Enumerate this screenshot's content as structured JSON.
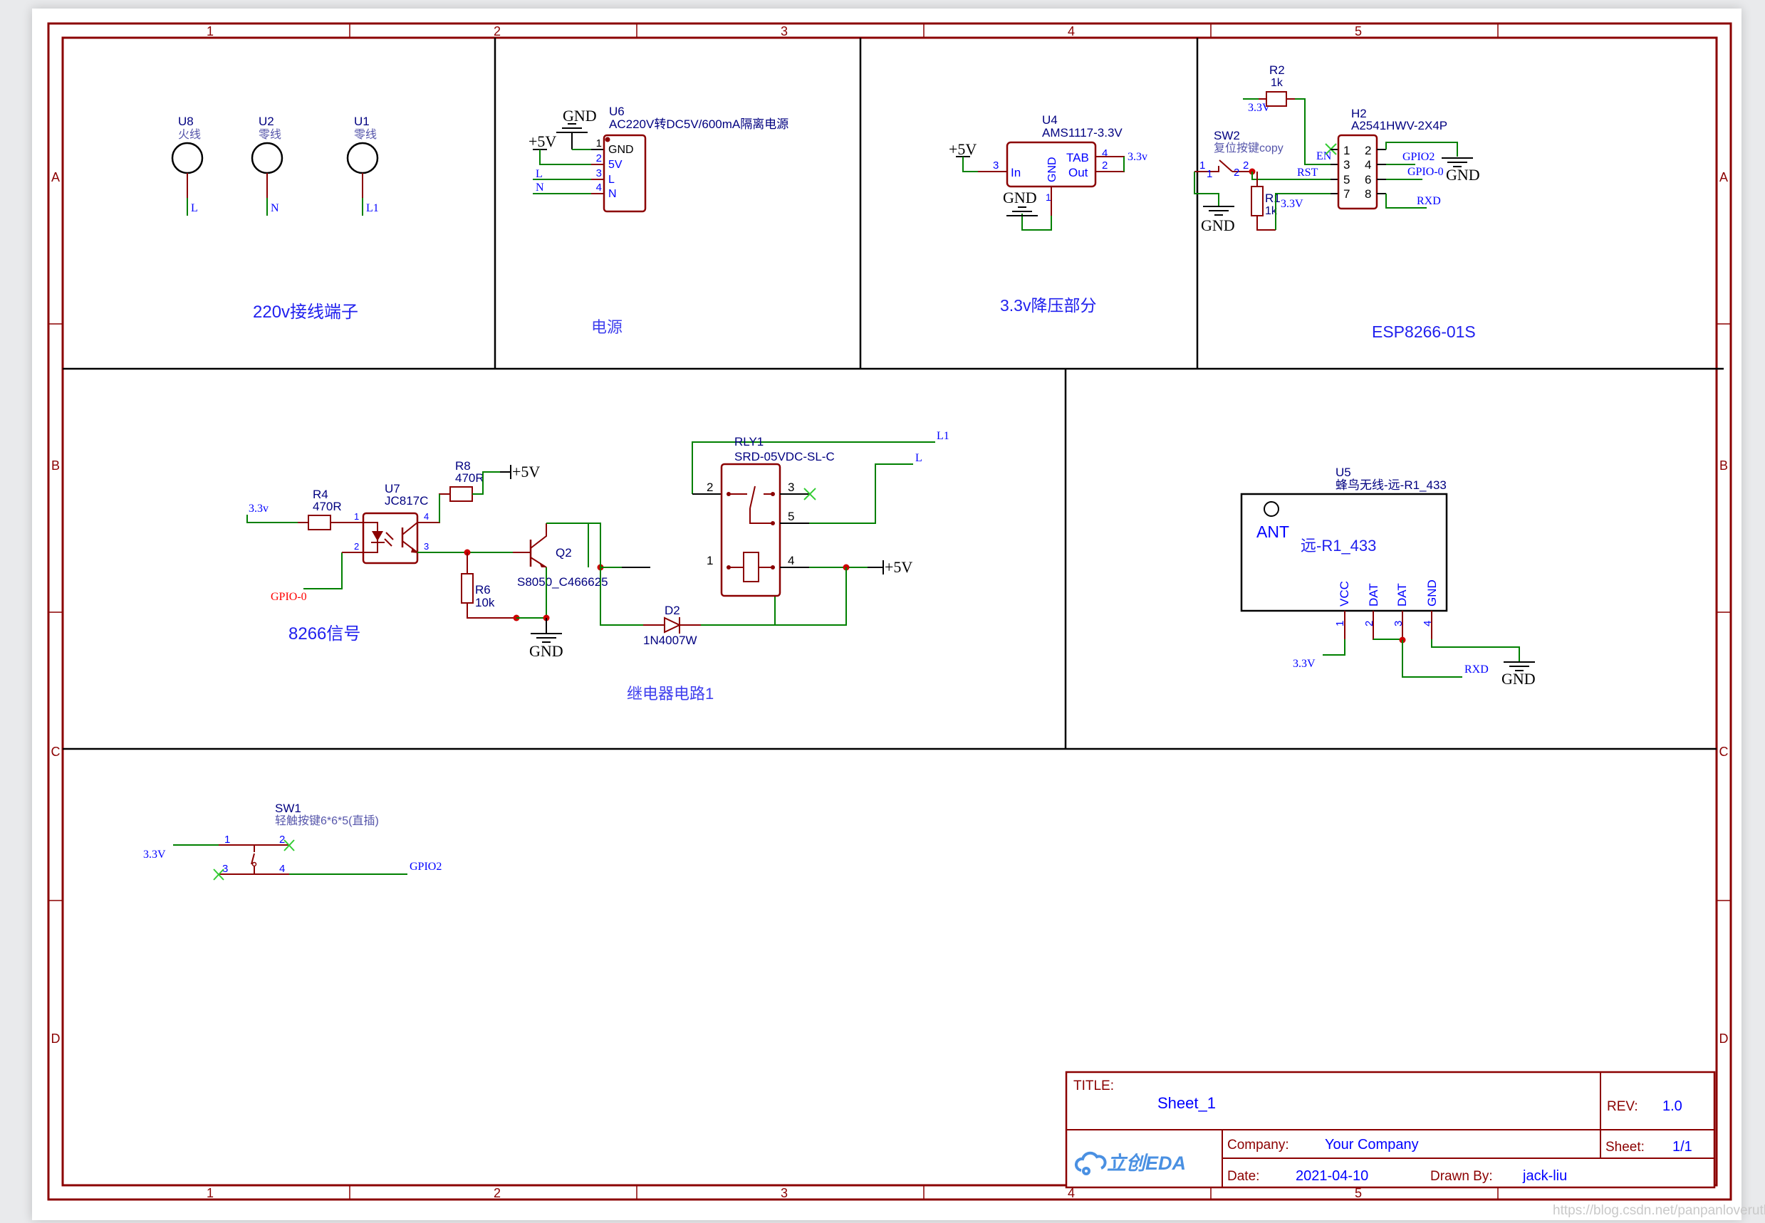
{
  "frame": {
    "columns": [
      "1",
      "2",
      "3",
      "4",
      "5"
    ],
    "rows": [
      "A",
      "B",
      "C",
      "D"
    ]
  },
  "colors": {
    "border": "#8b0000",
    "wire": "#008000",
    "component": "#8b0000",
    "net_label": "#0000ff",
    "designator": "#000080",
    "junction": "#cc0000",
    "no_connect": "#33cc33",
    "gpio0_label": "#ff0000"
  },
  "blocks": {
    "terminals": {
      "title": "220v接线端子",
      "parts": [
        {
          "ref": "U8",
          "value": "火线",
          "net": "L"
        },
        {
          "ref": "U2",
          "value": "零线",
          "net": "N"
        },
        {
          "ref": "U1",
          "value": "零线",
          "net": "L1"
        }
      ]
    },
    "power": {
      "title": "电源",
      "ref": "U6",
      "value": "AC220V转DC5V/600mA隔离电源",
      "pins": [
        {
          "num": "1",
          "name": "GND"
        },
        {
          "num": "2",
          "name": "5V"
        },
        {
          "num": "3",
          "name": "L"
        },
        {
          "num": "4",
          "name": "N"
        }
      ],
      "nets": {
        "gnd": "GND",
        "vcc": "+5V",
        "l": "L",
        "n": "N"
      }
    },
    "ldo": {
      "title": "3.3v降压部分",
      "ref": "U4",
      "value": "AMS1117-3.3V",
      "pins": [
        {
          "num": "3",
          "name": "In"
        },
        {
          "num": "1",
          "name": "GND"
        },
        {
          "num": "4",
          "name": "TAB"
        },
        {
          "num": "2",
          "name": "Out"
        }
      ],
      "nets": {
        "in": "+5V",
        "gnd": "GND",
        "out": "3.3v"
      }
    },
    "esp": {
      "title": "ESP8266-01S",
      "r2": {
        "ref": "R2",
        "value": "1k"
      },
      "r1": {
        "ref": "R1",
        "value": "1k"
      },
      "sw2": {
        "ref": "SW2",
        "value": "复位按键copy",
        "pin1": "1",
        "pin2": "2"
      },
      "header": {
        "ref": "H2",
        "value": "A2541HWV-2X4P",
        "pins": [
          "1",
          "2",
          "3",
          "4",
          "5",
          "6",
          "7",
          "8"
        ]
      },
      "nets": {
        "vcc_r2": "3.3V",
        "en": "EN",
        "rst": "RST",
        "vcc_r1": "3.3V",
        "gnd_left": "GND",
        "gnd_right": "GND",
        "gpio2": "GPIO2",
        "gpio0": "GPIO-0",
        "rxd": "RXD"
      }
    },
    "relay": {
      "title": "继电器电路1",
      "signal_label": "8266信号",
      "r4": {
        "ref": "R4",
        "value": "470R"
      },
      "r8": {
        "ref": "R8",
        "value": "470R"
      },
      "r6": {
        "ref": "R6",
        "value": "10k"
      },
      "u7": {
        "ref": "U7",
        "value": "JC817C",
        "pins": [
          "1",
          "2",
          "3",
          "4"
        ]
      },
      "q2": {
        "ref": "Q2",
        "value": "S8050_C466625"
      },
      "rly": {
        "ref": "RLY1",
        "value": "SRD-05VDC-SL-C",
        "pins": [
          "1",
          "2",
          "3",
          "4",
          "5"
        ]
      },
      "d2": {
        "ref": "D2",
        "value": "1N4007W"
      },
      "nets": {
        "in_vcc": "3.3v",
        "gpio": "GPIO-0",
        "vcc5_top": "+5V",
        "vcc5_right": "+5V",
        "gnd": "GND",
        "l1": "L1",
        "l": "L"
      }
    },
    "rf": {
      "ref": "U5",
      "value": "蜂鸟无线-远-R1_433",
      "ant": "ANT",
      "inner": "远-R1_433",
      "pins": [
        {
          "num": "1",
          "name": "VCC"
        },
        {
          "num": "2",
          "name": "DAT"
        },
        {
          "num": "3",
          "name": "DAT"
        },
        {
          "num": "4",
          "name": "GND"
        }
      ],
      "nets": {
        "vcc": "3.3V",
        "rxd": "RXD",
        "gnd": "GND"
      }
    },
    "button": {
      "ref": "SW1",
      "value": "轻触按键6*6*5(直插)",
      "pins": [
        "1",
        "2",
        "3",
        "4"
      ],
      "nets": {
        "vcc": "3.3V",
        "gpio": "GPIO2"
      }
    }
  },
  "title_block": {
    "title_label": "TITLE:",
    "title": "Sheet_1",
    "rev_label": "REV:",
    "rev": "1.0",
    "company_label": "Company:",
    "company": "Your Company",
    "sheet_label": "Sheet:",
    "sheet": "1/1",
    "date_label": "Date:",
    "date": "2021-04-10",
    "drawn_label": "Drawn By:",
    "drawn": "jack-liu",
    "logo": "立创EDA"
  },
  "watermark": "https://blog.csdn.net/panpanloveruth"
}
